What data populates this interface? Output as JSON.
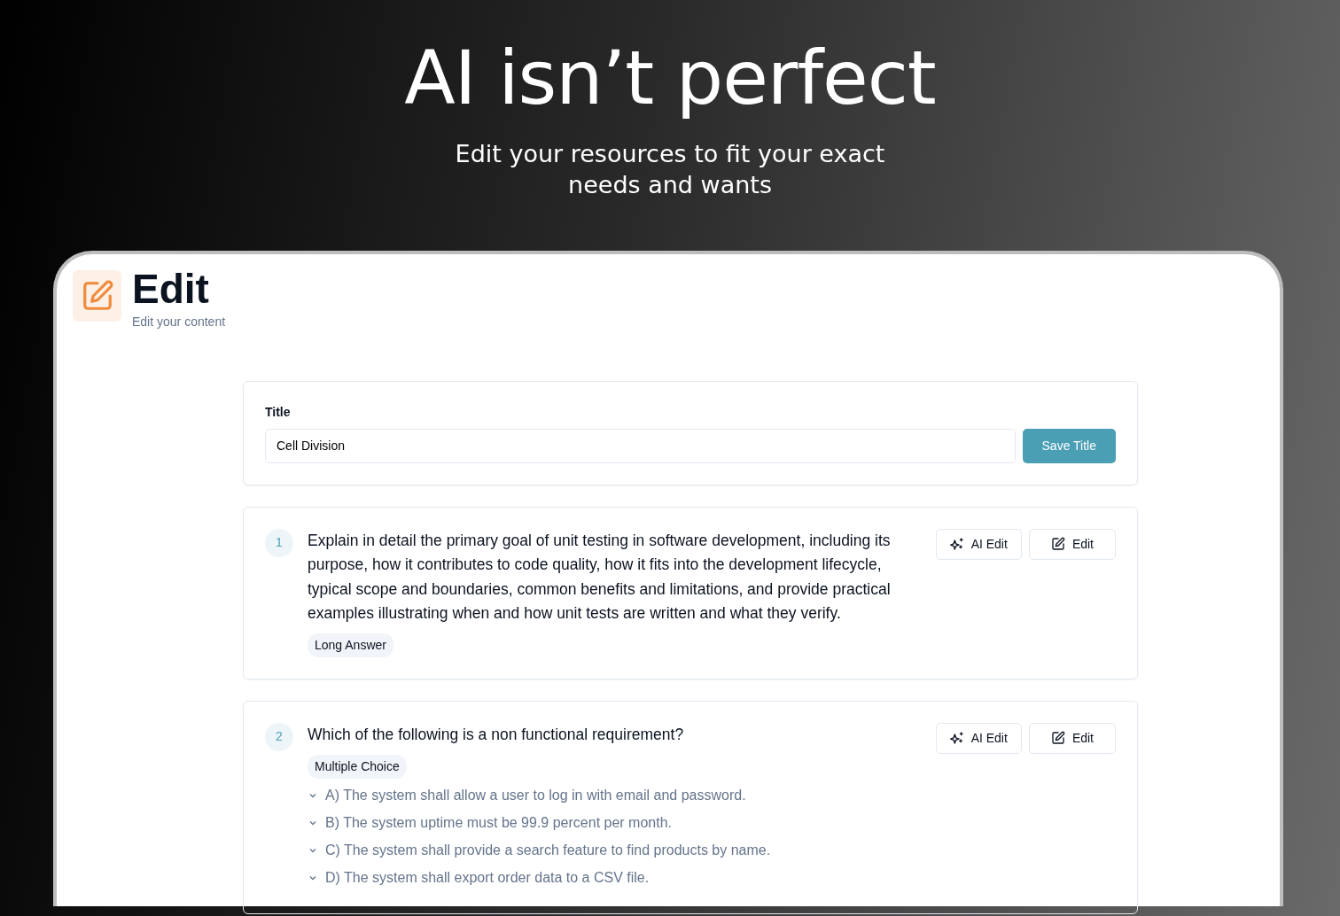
{
  "hero": {
    "title": "AI isn’t perfect",
    "subtitle": "Edit your resources to fit your exact needs and wants"
  },
  "page_header": {
    "title": "Edit",
    "subtitle": "Edit your content"
  },
  "title_form": {
    "label": "Title",
    "value": "Cell Division",
    "button": "Save Title"
  },
  "questions": [
    {
      "number": "1",
      "text": "Explain in detail the primary goal of unit testing in software development, including its purpose, how it contributes to code quality, how it fits into the development lifecycle, typical scope and boundaries, common benefits and limitations, and provide practical examples illustrating when and how unit tests are written and what they verify.",
      "type": "Long Answer",
      "buttons": [
        "AI Edit",
        "Edit"
      ]
    },
    {
      "number": "2",
      "text": "Which of the following is a non functional requirement?",
      "type": "Multiple Choice",
      "buttons": [
        "AI Edit",
        "Edit"
      ],
      "options": [
        "A) The system shall allow a user to log in with email and password.",
        "B) The system uptime must be 99.9 percent per month.",
        "C) The system shall provide a search feature to find products by name.",
        "D) The system shall export order data to a CSV file."
      ]
    }
  ]
}
